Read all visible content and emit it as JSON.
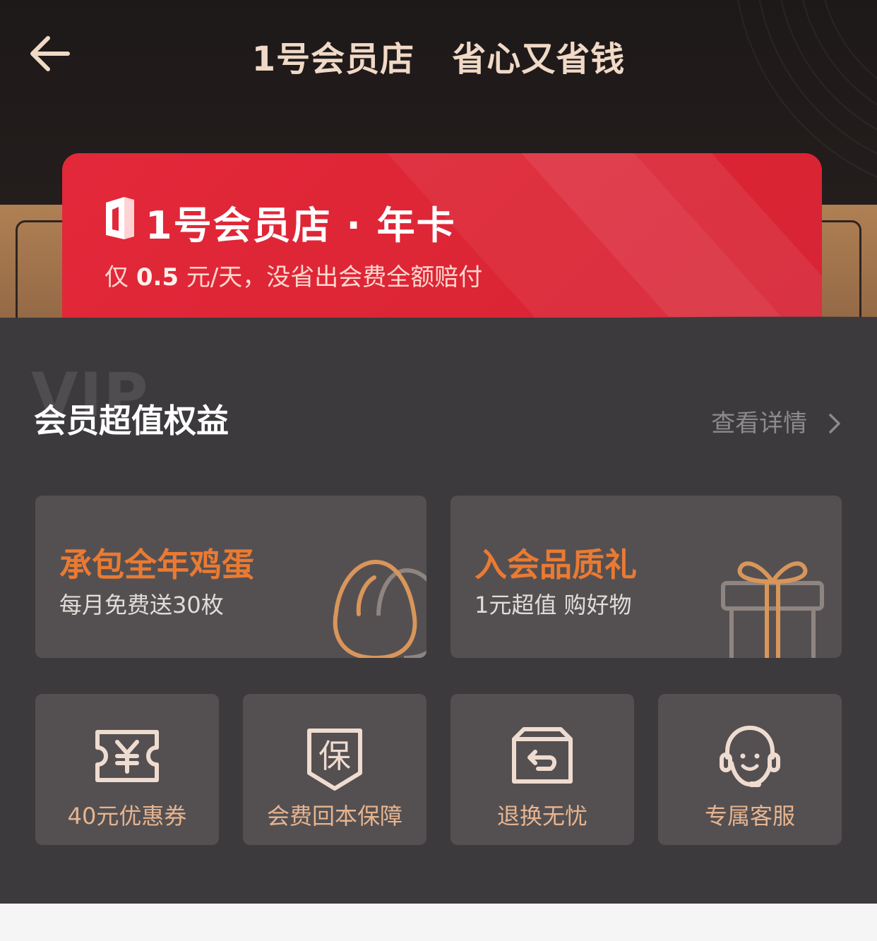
{
  "header": {
    "title": "1号会员店   省心又省钱",
    "back_icon": "back-arrow-icon"
  },
  "member_card": {
    "title": "1号会员店 · 年卡",
    "subtitle_prefix": "仅 ",
    "subtitle_price": "0.5",
    "subtitle_suffix": " 元/天，没省出会费全额赔付",
    "colors": {
      "card": "#e3283a",
      "text": "#ffffff"
    }
  },
  "benefits": {
    "watermark": "VIP",
    "title": "会员超值权益",
    "details_label": "查看详情",
    "big_tiles": [
      {
        "title": "承包全年鸡蛋",
        "subtitle": "每月免费送30枚",
        "icon": "egg-icon"
      },
      {
        "title": "入会品质礼",
        "subtitle": "1元超值 购好物",
        "icon": "gift-icon"
      }
    ],
    "small_tiles": [
      {
        "label": "40元优惠券",
        "icon": "coupon-yen-icon"
      },
      {
        "label": "会费回本保障",
        "icon": "shield-guarantee-icon"
      },
      {
        "label": "退换无忧",
        "icon": "return-box-icon"
      },
      {
        "label": "专属客服",
        "icon": "headset-support-icon"
      }
    ],
    "colors": {
      "accent": "#ea7a32",
      "icon": "#e6b48f",
      "tile": "#545052",
      "panel": "#3c3a3d"
    }
  }
}
